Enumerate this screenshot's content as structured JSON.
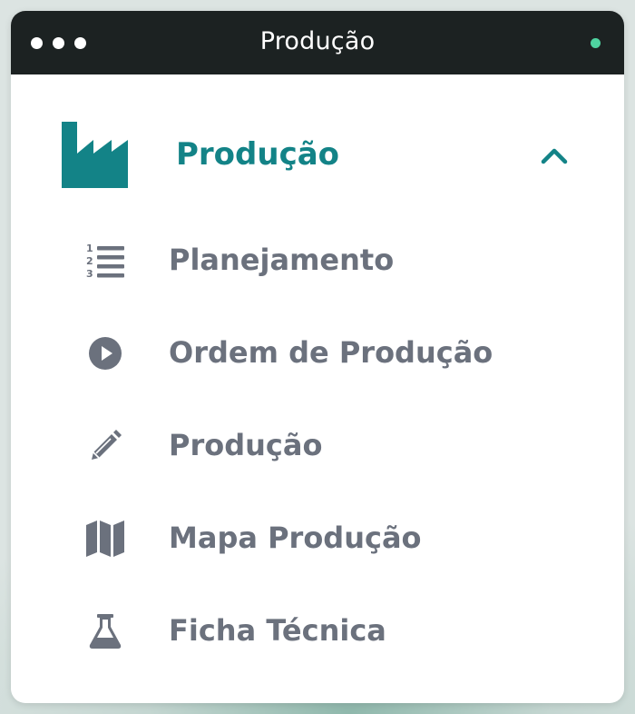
{
  "window": {
    "title": "Produção",
    "status_color": "#4fd3a0"
  },
  "menu": {
    "header": {
      "label": "Produção",
      "icon": "factory-icon",
      "toggle_icon": "chevron-up-icon",
      "expanded": true
    },
    "items": [
      {
        "label": "Planejamento",
        "icon": "numbered-list-icon"
      },
      {
        "label": "Ordem de Produção",
        "icon": "play-circle-icon"
      },
      {
        "label": "Produção",
        "icon": "pencil-icon"
      },
      {
        "label": "Mapa Produção",
        "icon": "map-icon"
      },
      {
        "label": "Ficha Técnica",
        "icon": "flask-icon"
      }
    ]
  },
  "colors": {
    "accent": "#138387",
    "titlebar": "#1c2222",
    "item_text": "#6b717d",
    "icon": "#6b717d"
  }
}
